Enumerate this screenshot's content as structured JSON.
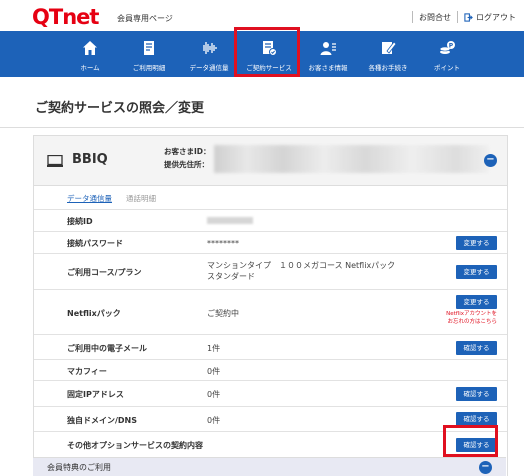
{
  "header": {
    "logo_q": "Q",
    "logo_t": "T",
    "logo_net": "net",
    "member_label": "会員専用ページ",
    "inquiry_label": "お問合せ",
    "logout_label": "ログアウト"
  },
  "nav": [
    {
      "label": "ホーム",
      "icon": "home-icon"
    },
    {
      "label": "ご利用明細",
      "icon": "statement-icon"
    },
    {
      "label": "データ通信量",
      "icon": "data-traffic-icon"
    },
    {
      "label": "ご契約サービス",
      "icon": "contract-icon"
    },
    {
      "label": "お客さま情報",
      "icon": "customer-info-icon"
    },
    {
      "label": "各種お手続き",
      "icon": "procedure-icon"
    },
    {
      "label": "ポイント",
      "icon": "point-icon"
    }
  ],
  "page_title": "ご契約サービスの照会／変更",
  "service": {
    "name": "BBIQ",
    "customer_id_label": "お客さまID：",
    "address_label": "提供先住所："
  },
  "tabs": {
    "data_usage": "データ通信量",
    "call_details": "通話明細"
  },
  "rows": [
    {
      "key": "接続ID",
      "value": ""
    },
    {
      "key": "接続パスワード",
      "value": "********",
      "button": "変更する"
    },
    {
      "key": "ご利用コース/プラン",
      "value_line1": "マンションタイプ　１００メガコース Netflixパック",
      "value_line2": "スタンダード",
      "button": "変更する"
    },
    {
      "key": "Netflixパック",
      "value": "ご契約中",
      "button": "変更する",
      "note_line1": "Netflixアカウントを",
      "note_line2": "お忘れの方はこちら"
    },
    {
      "key": "ご利用中の電子メール",
      "value": "1件",
      "button": "確認する"
    },
    {
      "key": "マカフィー",
      "value": "0件"
    },
    {
      "key": "固定IPアドレス",
      "value": "0件",
      "button": "確認する"
    },
    {
      "key": "独自ドメイン/DNS",
      "value": "0件",
      "button": "確認する"
    },
    {
      "key": "その他オプションサービスの契約内容",
      "value": "",
      "button": "確認する"
    }
  ],
  "member_benefits": "会員特典のご利用",
  "colors": {
    "brand_red": "#e60012",
    "nav_blue": "#1d62b8",
    "highlight_red": "#e01020"
  }
}
